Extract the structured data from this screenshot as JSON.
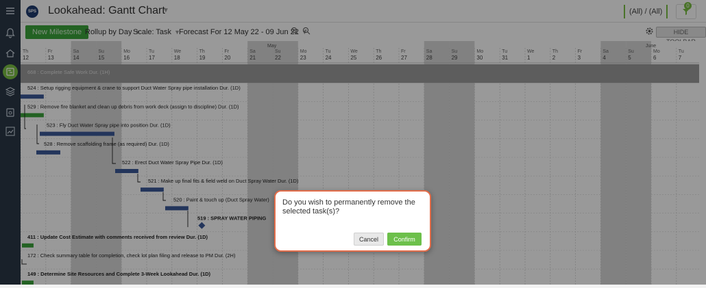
{
  "app": {
    "logo_text": "SPS",
    "title": "Lookahead: Gantt Chart"
  },
  "header": {
    "filter_text": "(All) / (All)",
    "filter_badge": "0"
  },
  "sidebar": {
    "icons": [
      "menu-icon",
      "bell-icon",
      "home-icon",
      "gantt-icon",
      "layers-icon",
      "clipboard-icon",
      "chart-icon"
    ]
  },
  "toolbar": {
    "new_milestone": "New Milestone",
    "rollup": "Rollup by Day",
    "scale": "Scale: Task",
    "forecast": "Forecast For 12 May 22 - 09 Jun 22",
    "hide_toolbar": "HIDE TOOLBAR"
  },
  "timeline": {
    "months": [
      {
        "label": "May",
        "col": 10
      },
      {
        "label": "June",
        "col": 25
      }
    ],
    "days": [
      {
        "dow": "Th",
        "day": "12",
        "weekend": false
      },
      {
        "dow": "Fr",
        "day": "13",
        "weekend": false
      },
      {
        "dow": "Sa",
        "day": "14",
        "weekend": true
      },
      {
        "dow": "Su",
        "day": "15",
        "weekend": true
      },
      {
        "dow": "Mo",
        "day": "16",
        "weekend": false
      },
      {
        "dow": "Tu",
        "day": "17",
        "weekend": false
      },
      {
        "dow": "We",
        "day": "18",
        "weekend": false
      },
      {
        "dow": "Th",
        "day": "19",
        "weekend": false
      },
      {
        "dow": "Fr",
        "day": "20",
        "weekend": false
      },
      {
        "dow": "Sa",
        "day": "21",
        "weekend": true
      },
      {
        "dow": "Su",
        "day": "22",
        "weekend": true
      },
      {
        "dow": "Mo",
        "day": "23",
        "weekend": false
      },
      {
        "dow": "Tu",
        "day": "24",
        "weekend": false
      },
      {
        "dow": "We",
        "day": "25",
        "weekend": false
      },
      {
        "dow": "Th",
        "day": "26",
        "weekend": false
      },
      {
        "dow": "Fr",
        "day": "27",
        "weekend": false
      },
      {
        "dow": "Sa",
        "day": "28",
        "weekend": true
      },
      {
        "dow": "Su",
        "day": "29",
        "weekend": true
      },
      {
        "dow": "Mo",
        "day": "30",
        "weekend": false
      },
      {
        "dow": "Tu",
        "day": "31",
        "weekend": false
      },
      {
        "dow": "We",
        "day": "1",
        "weekend": false
      },
      {
        "dow": "Th",
        "day": "2",
        "weekend": false
      },
      {
        "dow": "Fr",
        "day": "3",
        "weekend": false
      },
      {
        "dow": "Sa",
        "day": "4",
        "weekend": true
      },
      {
        "dow": "Su",
        "day": "5",
        "weekend": true
      },
      {
        "dow": "Mo",
        "day": "6",
        "weekend": false
      },
      {
        "dow": "Tu",
        "day": "7",
        "weekend": false
      }
    ]
  },
  "tasks": [
    {
      "label": "668 : Complete Safe Work Dur. (1H)",
      "kind": "summary",
      "start": 0,
      "dur": 0,
      "bold": false
    },
    {
      "label": "524 : Setup rigging equipment & crane to support Duct Water Spray pipe installation Dur. (1D)",
      "kind": "task",
      "start": 0,
      "dur": 1,
      "bold": false
    },
    {
      "label": "529 : Remove fire blanket and clean up debris from work deck (assign to discipline) Dur. (1D)",
      "kind": "task-green",
      "start": 0,
      "dur": 1,
      "bold": false
    },
    {
      "label": "523 : Fly Duct Water Spray pipe into position Dur. (1D)",
      "kind": "task",
      "start": 1,
      "dur": 4,
      "bold": false
    },
    {
      "label": "528 : Remove scaffolding frame (as required) Dur. (1D)",
      "kind": "task",
      "start": 1,
      "dur": 1,
      "bold": false
    },
    {
      "label": "522 : Erect Duct Water Spray Pipe Dur. (1D)",
      "kind": "task",
      "start": 5,
      "dur": 1,
      "bold": false
    },
    {
      "label": "521 : Make up final fits & field weld on Duct Spray Water Dur. (1D)",
      "kind": "task",
      "start": 6,
      "dur": 1,
      "bold": false
    },
    {
      "label": "520 : Paint & touch up (Duct Spray Water)",
      "kind": "task",
      "start": 7,
      "dur": 1,
      "bold": false
    },
    {
      "label": "519 : SPRAY WATER PIPING",
      "kind": "milestone",
      "start": 8,
      "dur": 0,
      "bold": true
    },
    {
      "label": "411 : Update Cost Estimate with comments received from review Dur. (1D)",
      "kind": "task-green",
      "start": 0,
      "dur": 0.5,
      "bold": true
    },
    {
      "label": "172 : Check summary table for completion, check lot plan filing and release to PM Dur. (2H)",
      "kind": "bracket",
      "start": 0,
      "dur": 0.2,
      "bold": false
    },
    {
      "label": "149 : Determine Site Resources and Complete 3-Week Lookahead Dur. (1D)",
      "kind": "task-green",
      "start": 0,
      "dur": 0.5,
      "bold": true
    }
  ],
  "dialog": {
    "message": "Do you wish to permanently remove the selected task(s)?",
    "cancel": "Cancel",
    "confirm": "Confirm"
  },
  "colors": {
    "task_bar": "#3b5998",
    "green_bar": "#3ba43b",
    "weekend": "#d8d8d8",
    "summary_row": "#9b9b9b",
    "dialog_border": "#e36d4a",
    "confirm": "#6cc04a"
  }
}
